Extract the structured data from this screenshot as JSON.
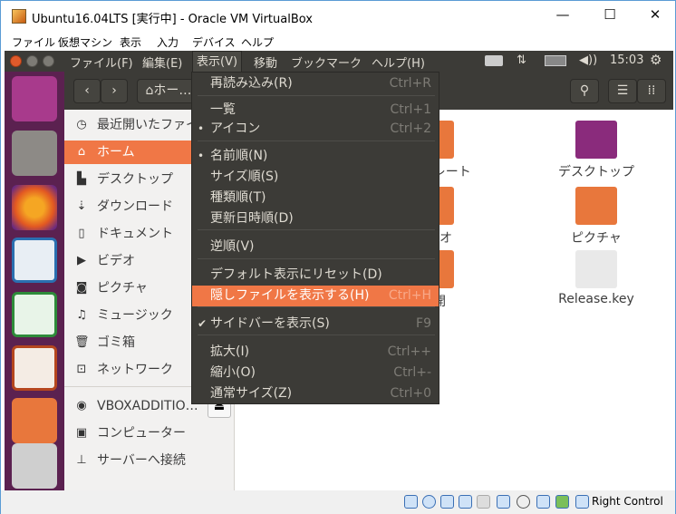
{
  "window": {
    "title": "Ubuntu16.04LTS [実行中] - Oracle VM VirtualBox",
    "minimize": "—",
    "maximize": "☐",
    "close": "✕"
  },
  "vbox_menu": [
    "ファイル",
    "仮想マシン",
    "表示",
    "入力",
    "デバイス",
    "ヘルプ"
  ],
  "ubuntu_menu": [
    "ファイル(F)",
    "編集(E)",
    "表示(V)",
    "移動",
    "ブックマーク",
    "ヘルプ(H)"
  ],
  "panel": {
    "clock": "15:03"
  },
  "toolbar": {
    "back": "‹",
    "forward": "›",
    "path": "⌂ホー…"
  },
  "sidebar": [
    {
      "icon": "clock-icon",
      "glyph": "◷",
      "label": "最近開いたファイル"
    },
    {
      "icon": "home-icon",
      "glyph": "⌂",
      "label": "ホーム",
      "selected": true
    },
    {
      "icon": "folder-icon",
      "glyph": "▙",
      "label": "デスクトップ"
    },
    {
      "icon": "download-icon",
      "glyph": "⇣",
      "label": "ダウンロード"
    },
    {
      "icon": "document-icon",
      "glyph": "▯",
      "label": "ドキュメント"
    },
    {
      "icon": "video-icon",
      "glyph": "▶",
      "label": "ビデオ"
    },
    {
      "icon": "camera-icon",
      "glyph": "◙",
      "label": "ピクチャ"
    },
    {
      "icon": "music-icon",
      "glyph": "♫",
      "label": "ミュージック"
    },
    {
      "icon": "trash-icon",
      "glyph": "🗑",
      "label": "ゴミ箱"
    },
    {
      "icon": "network-icon",
      "glyph": "⊡",
      "label": "ネットワーク"
    },
    {
      "icon": "disc-icon",
      "glyph": "◉",
      "label": "VBOXADDITIO…"
    },
    {
      "icon": "computer-icon",
      "glyph": "▣",
      "label": "コンピューター"
    },
    {
      "icon": "server-icon",
      "glyph": "⊥",
      "label": "サーバーへ接続"
    }
  ],
  "eject": "⏏",
  "files": [
    {
      "name": "テンプレート",
      "color": "#e8773c"
    },
    {
      "name": "デスクトップ",
      "color": "#8a2b7c"
    },
    {
      "name": "ビデオ",
      "color": "#e8773c"
    },
    {
      "name": "ピクチャ",
      "color": "#e8773c"
    },
    {
      "name": "公開",
      "color": "#e8773c"
    },
    {
      "name": "Release.key",
      "color": "#e9e9e9"
    }
  ],
  "view_menu": [
    {
      "label": "再読み込み(R)",
      "shortcut": "Ctrl+R"
    },
    {
      "label": "一覧",
      "shortcut": "Ctrl+1"
    },
    {
      "label": "アイコン",
      "shortcut": "Ctrl+2",
      "mark": "•"
    },
    {
      "label": "名前順(N)",
      "shortcut": "",
      "mark": "•"
    },
    {
      "label": "サイズ順(S)",
      "shortcut": ""
    },
    {
      "label": "種類順(T)",
      "shortcut": ""
    },
    {
      "label": "更新日時順(D)",
      "shortcut": ""
    },
    {
      "label": "逆順(V)",
      "shortcut": ""
    },
    {
      "label": "デフォルト表示にリセット(D)",
      "shortcut": ""
    },
    {
      "label": "隠しファイルを表示する(H)",
      "shortcut": "Ctrl+H",
      "highlighted": true
    },
    {
      "label": "サイドバーを表示(S)",
      "shortcut": "F9",
      "mark": "✔"
    },
    {
      "label": "拡大(I)",
      "shortcut": "Ctrl++"
    },
    {
      "label": "縮小(O)",
      "shortcut": "Ctrl+-"
    },
    {
      "label": "通常サイズ(Z)",
      "shortcut": "Ctrl+0"
    }
  ],
  "statusbar": {
    "host_key": "Right Control"
  },
  "colors": {
    "accent": "#f07746",
    "panel": "#3c3b37",
    "launcher": "#5b2150"
  }
}
